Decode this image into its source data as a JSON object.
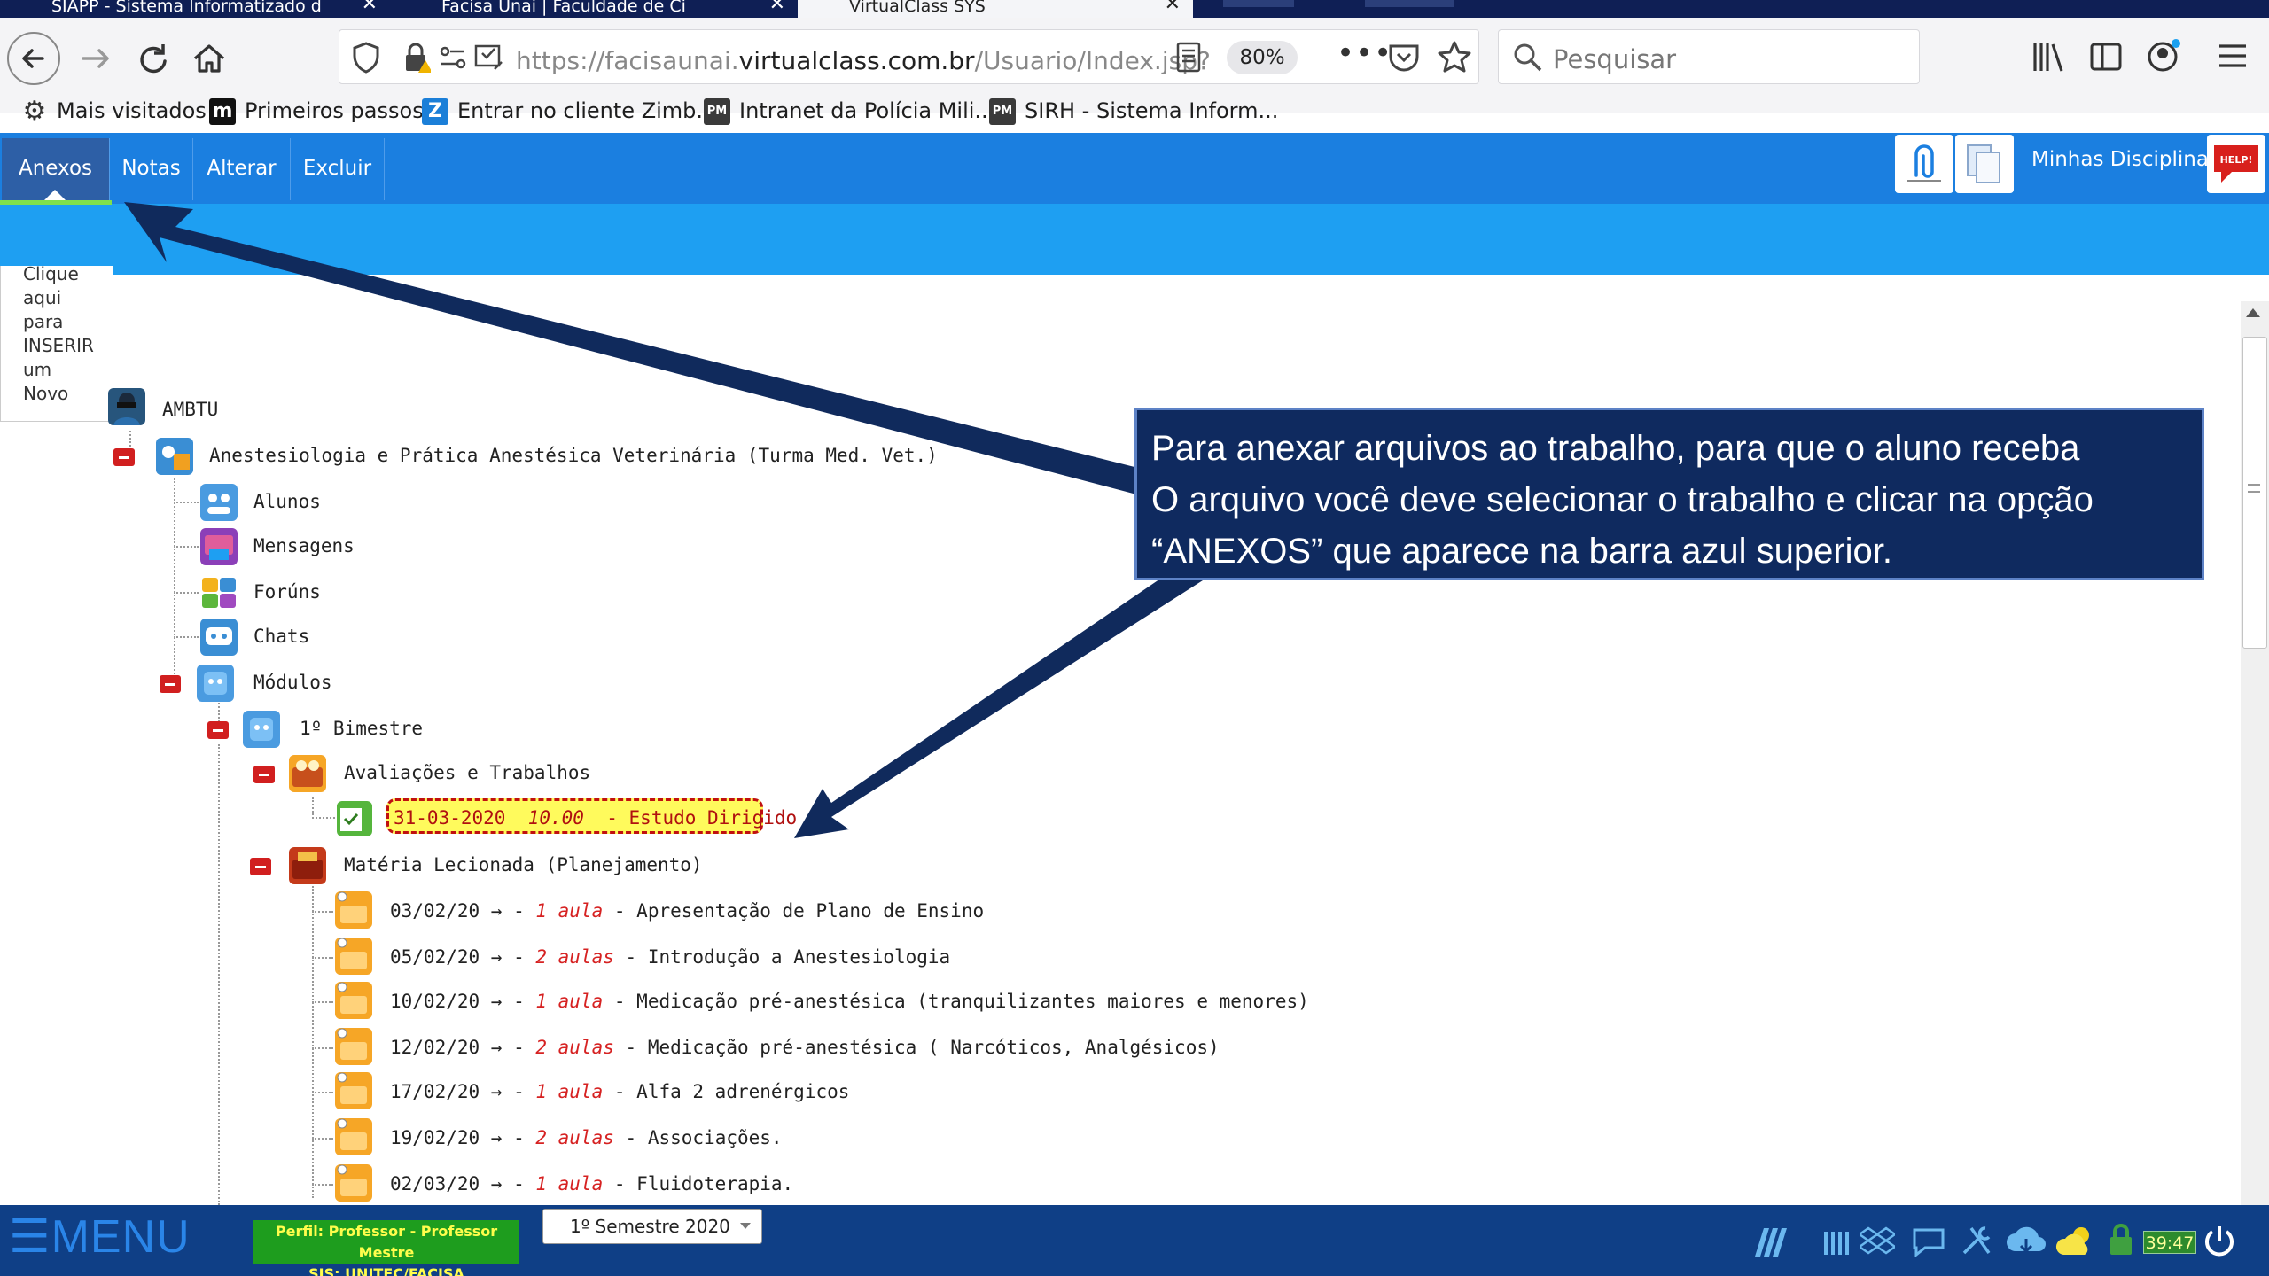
{
  "browser": {
    "tabs": [
      {
        "label": "SIAPP - Sistema Informatizado d"
      },
      {
        "label": "Facisa Unai | Faculdade de Ci"
      },
      {
        "label": "VirtualClass SYS"
      }
    ],
    "url_prefix": "https://facisaunai.",
    "url_domain": "virtualclass.com.br",
    "url_path": "/Usuario/Index.jsp?",
    "zoom": "80%",
    "search_placeholder": "Pesquisar",
    "bookmarks": [
      {
        "label": "Mais visitados",
        "icon": "gear-icon"
      },
      {
        "label": "Primeiros passos",
        "icon": "m-logo-icon"
      },
      {
        "label": "Entrar no cliente Zimb...",
        "icon": "z-logo-icon"
      },
      {
        "label": "Intranet da Polícia Mili...",
        "icon": "pm-logo-icon"
      },
      {
        "label": "SIRH - Sistema Inform...",
        "icon": "pm-logo-icon"
      }
    ]
  },
  "appnav": {
    "items": [
      "Anexos",
      "Notas",
      "Alterar",
      "Excluir"
    ],
    "selected": "Anexos",
    "my_disciplines": "Minhas Disciplinas",
    "help_label": "HELP!"
  },
  "side": {
    "text": "Clique\naqui\npara\nINSERIR\num\nNovo"
  },
  "tree": {
    "root": "AMBTU",
    "course": "Anestesiologia e Prática Anestésica Veterinária (Turma Med. Vet.)",
    "alunos": "Alunos",
    "mensagens": "Mensagens",
    "foruns": "Forúns",
    "chats": "Chats",
    "modulos": "Módulos",
    "bimestre": "1º Bimestre",
    "avaliacoes": "Avaliações e Trabalhos",
    "item_date": "31-03-2020",
    "item_grade": "10.00",
    "item_name": "- Estudo Dirigido",
    "materia": "Matéria Lecionada (Planejamento)",
    "lessons": [
      {
        "date": "03/02/20 → -",
        "count": "1 aula",
        "title": "- Apresentação de Plano de Ensino"
      },
      {
        "date": "05/02/20 → -",
        "count": "2 aulas",
        "title": "- Introdução a Anestesiologia"
      },
      {
        "date": "10/02/20 → -",
        "count": "1 aula",
        "title": "- Medicação pré-anestésica (tranquilizantes maiores e menores)"
      },
      {
        "date": "12/02/20 → -",
        "count": "2 aulas",
        "title": "- Medicação pré-anestésica ( Narcóticos, Analgésicos)"
      },
      {
        "date": "17/02/20 → -",
        "count": "1 aula",
        "title": "- Alfa 2 adrenérgicos"
      },
      {
        "date": "19/02/20 → -",
        "count": "2 aulas",
        "title": "- Associações."
      },
      {
        "date": "02/03/20 → -",
        "count": "1 aula",
        "title": "- Fluidoterapia."
      }
    ]
  },
  "annotation": {
    "line1": "Para anexar arquivos ao trabalho, para que o aluno receba",
    "line2": "O arquivo você deve selecionar o trabalho e clicar na opção",
    "line3": "“ANEXOS” que aparece na barra azul superior."
  },
  "footer": {
    "menu_label": "☰MENU",
    "perfil_line1": "Perfil: Professor - Professor Mestre",
    "perfil_line2": "SIS: UNITEC/FACISA",
    "semester": "1º Semestre 2020",
    "clock": "39:47"
  },
  "colors": {
    "nav_blue": "#1b7fe0",
    "nav_light": "#1e9ff2",
    "callout_navy": "#0f2a5f",
    "arrow_navy": "#102a5c",
    "highlight_yellow": "#fffa5c"
  }
}
